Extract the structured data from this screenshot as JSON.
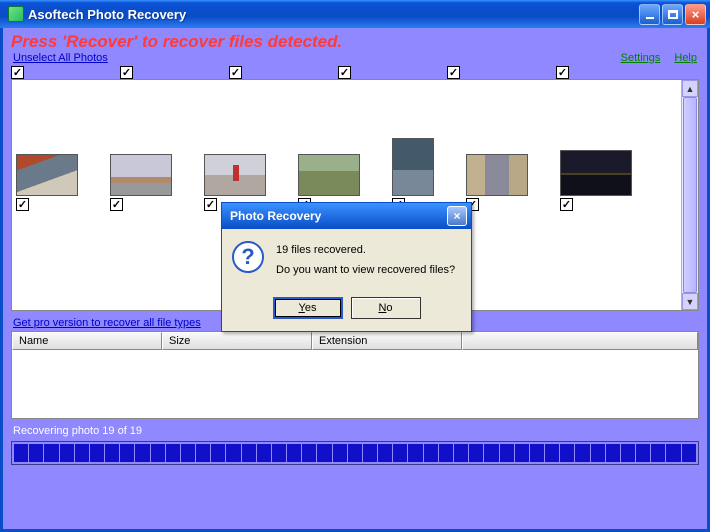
{
  "window": {
    "title": "Asoftech Photo Recovery"
  },
  "banner": "Press 'Recover' to recover files detected.",
  "links": {
    "unselect": "Unselect All Photos",
    "settings": "Settings",
    "help": "Help",
    "pro": "Get pro version to recover all file types"
  },
  "checkmark": "✓",
  "table": {
    "headers": [
      "Name",
      "Size",
      "Extension",
      ""
    ]
  },
  "status": "Recovering photo 19 of 19",
  "progress_segments": 45,
  "dialog": {
    "title": "Photo Recovery",
    "line1": "19 files recovered.",
    "line2": "Do you want to view recovered files?",
    "yes_pre": "",
    "yes_u": "Y",
    "yes_post": "es",
    "no_pre": "",
    "no_u": "N",
    "no_post": "o"
  }
}
